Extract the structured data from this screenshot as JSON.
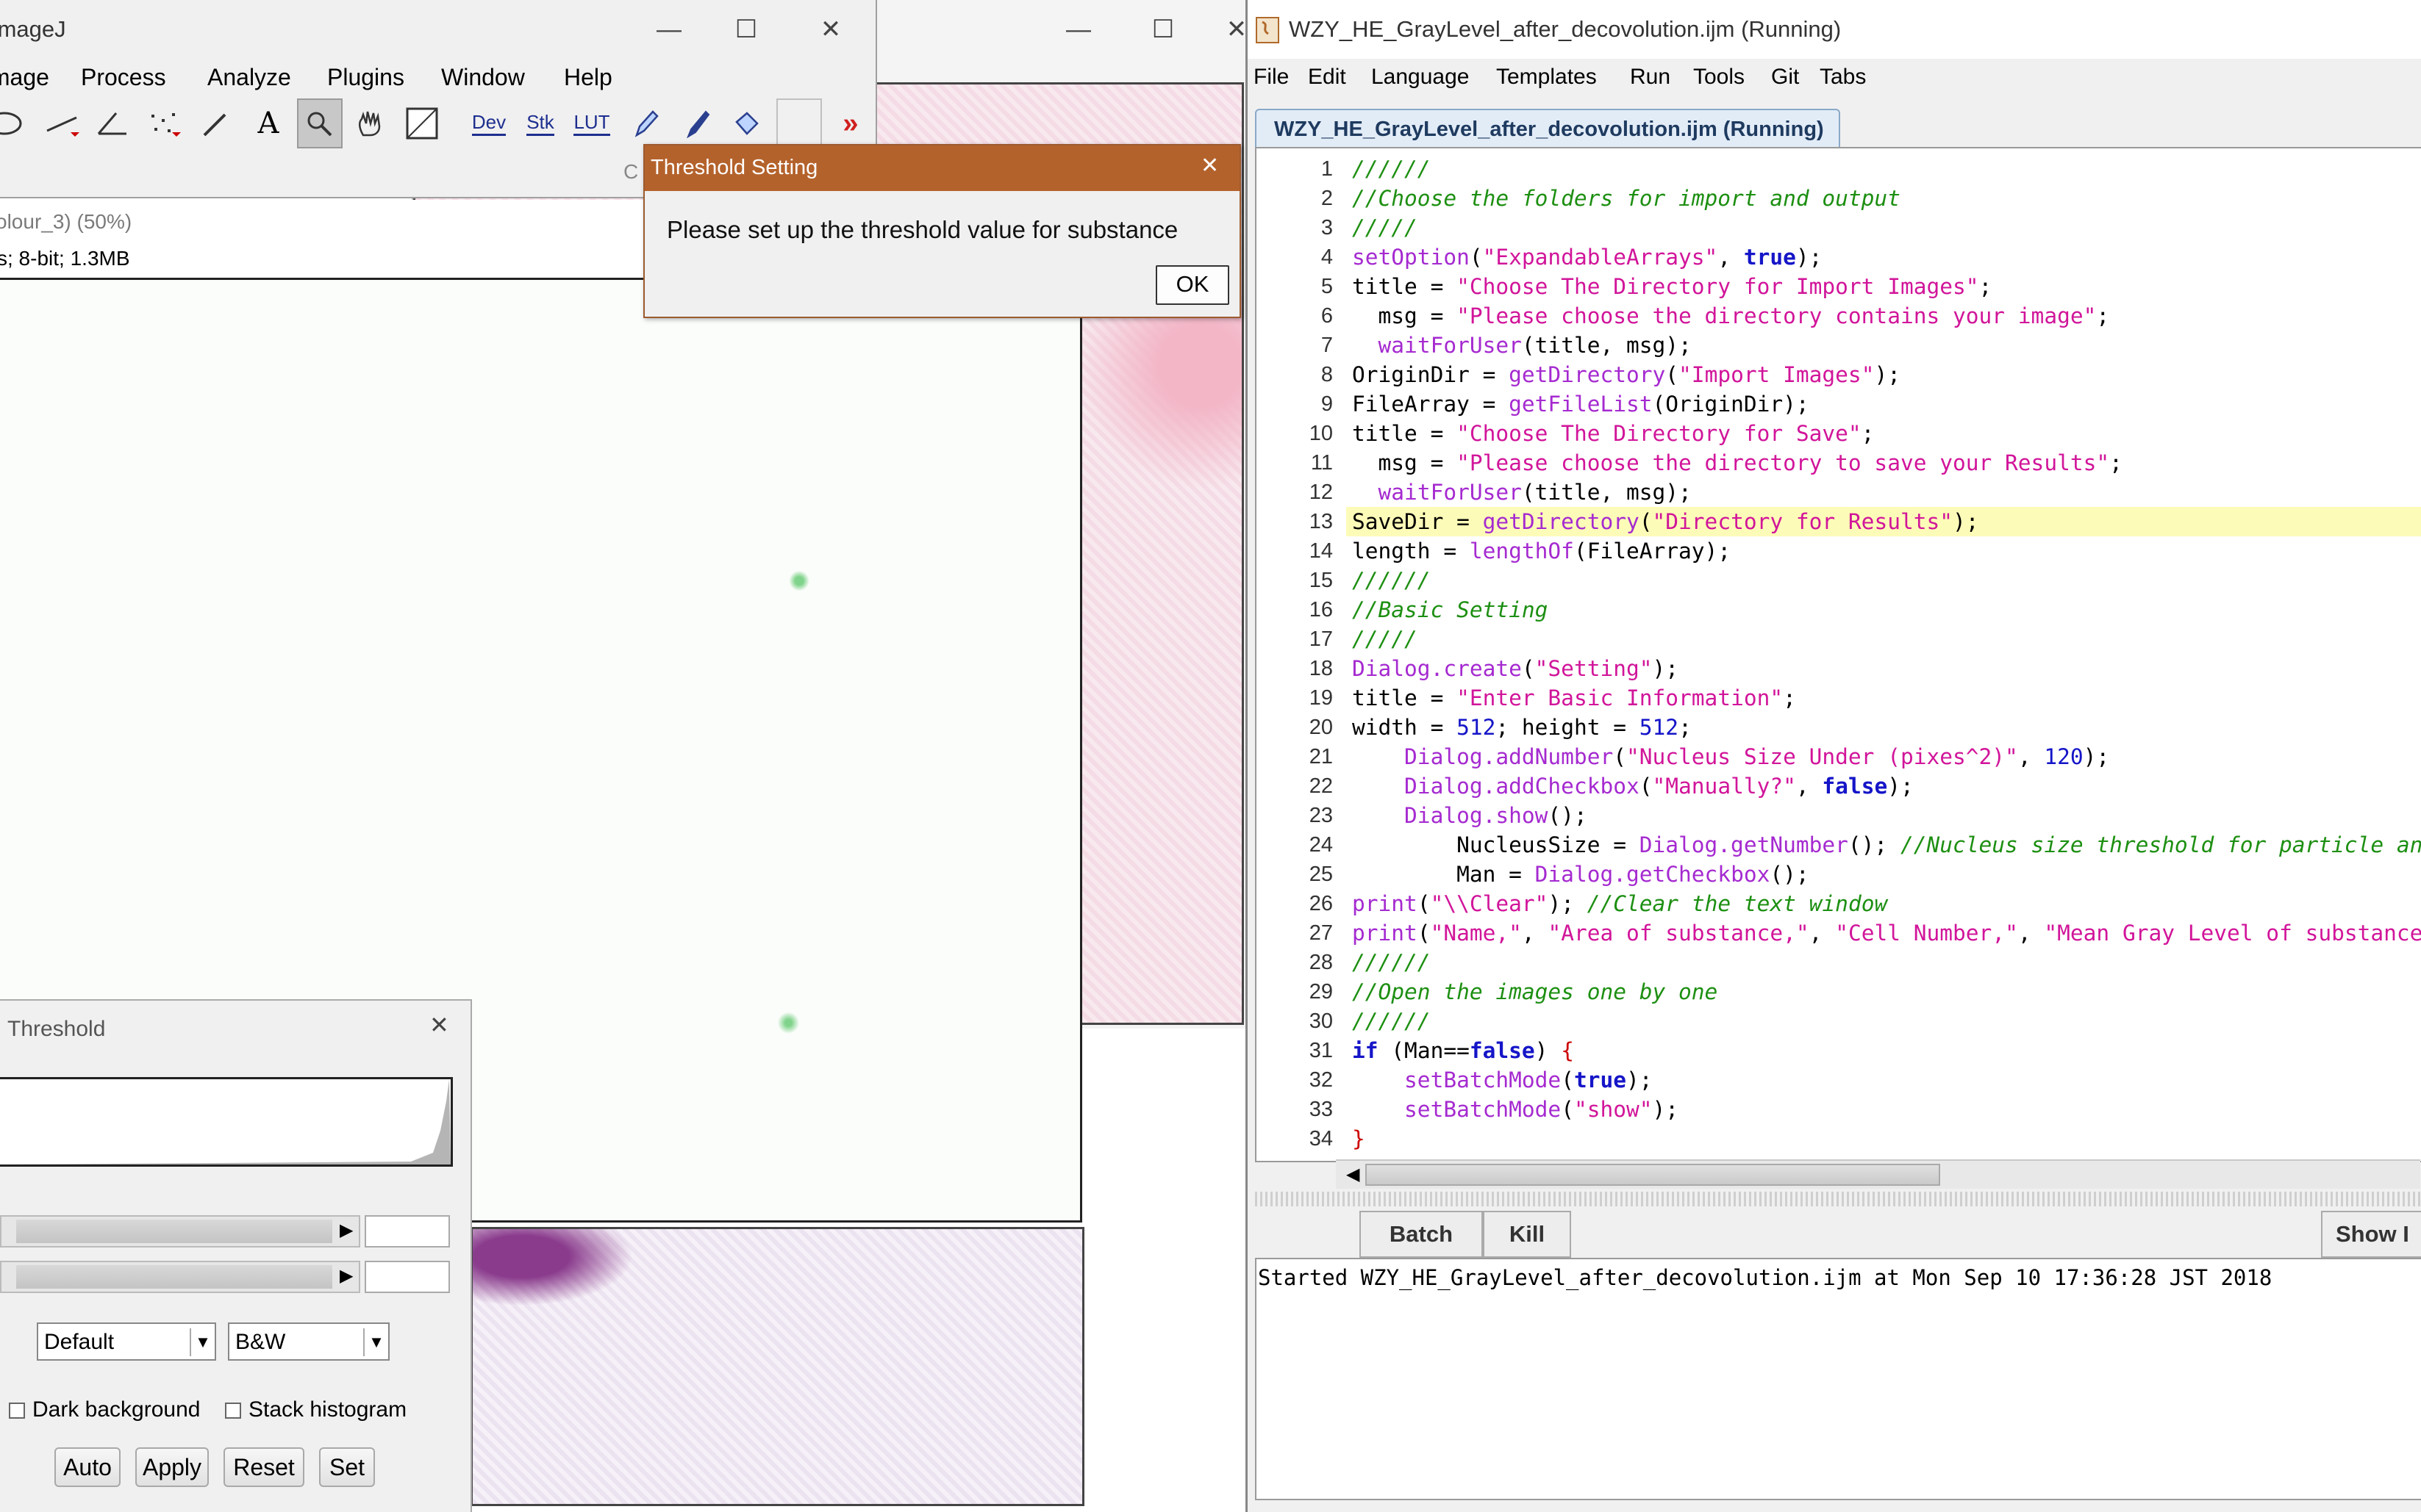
{
  "imagej": {
    "title": "ImageJ",
    "menus": [
      "Image",
      "Process",
      "Analyze",
      "Plugins",
      "Window",
      "Help"
    ],
    "tools": [
      {
        "icon": "freehand-selection-icon",
        "label": ""
      },
      {
        "icon": "straight-line-icon",
        "label": ""
      },
      {
        "icon": "angle-tool-icon",
        "label": ""
      },
      {
        "icon": "multi-point-icon",
        "label": ""
      },
      {
        "icon": "wand-tool-icon",
        "label": ""
      },
      {
        "icon": "text-tool-icon",
        "label": "A"
      },
      {
        "icon": "magnifier-icon",
        "label": ""
      },
      {
        "icon": "hand-tool-icon",
        "label": ""
      },
      {
        "icon": "color-picker-icon",
        "label": ""
      },
      {
        "icon": "dev-menu-icon",
        "label": "Dev"
      },
      {
        "icon": "stacks-menu-icon",
        "label": "Stk"
      },
      {
        "icon": "lut-menu-icon",
        "label": "LUT"
      },
      {
        "icon": "pencil-icon",
        "label": ""
      },
      {
        "icon": "brush-icon",
        "label": ""
      },
      {
        "icon": "flood-fill-icon",
        "label": ""
      },
      {
        "icon": "blank-tool-icon",
        "label": ""
      },
      {
        "icon": "more-tools-icon",
        "label": "»"
      }
    ],
    "status_fragment": "C"
  },
  "image_window": {
    "title": "olour_3) (50%)",
    "info": "s; 8-bit; 1.3MB"
  },
  "threshold_setting_dialog": {
    "title": "Threshold Setting",
    "message": "Please set up the threshold value for substance",
    "ok_label": "OK"
  },
  "threshold_panel": {
    "title": "Threshold",
    "method": "Default",
    "mode": "B&W",
    "dark_background_label": "Dark background",
    "stack_histogram_label": "Stack histogram",
    "dark_background_checked": false,
    "stack_histogram_checked": false,
    "buttons": [
      "Auto",
      "Apply",
      "Reset",
      "Set"
    ]
  },
  "editor": {
    "title": "WZY_HE_GrayLevel_after_decovolution.ijm (Running)",
    "tab_label": "WZY_HE_GrayLevel_after_decovolution.ijm (Running)",
    "menus": [
      "File",
      "Edit",
      "Language",
      "Templates",
      "Run",
      "Tools",
      "Git",
      "Tabs"
    ],
    "highlighted_line": 13,
    "line_numbers": [
      "1",
      "2",
      "3",
      "4",
      "5",
      "6",
      "7",
      "8",
      "9",
      "10",
      "11",
      "12",
      "13",
      "14",
      "15",
      "16",
      "17",
      "18",
      "19",
      "20",
      "21",
      "22",
      "23",
      "24",
      "25",
      "26",
      "27",
      "28",
      "29",
      "30",
      "31",
      "32",
      "33",
      "34"
    ],
    "code_lines": [
      "//////",
      "//Choose the folders for import and output",
      "/////",
      "setOption(\"ExpandableArrays\", true);",
      "title = \"Choose The Directory for Import Images\";",
      "  msg = \"Please choose the directory contains your image\";",
      "  waitForUser(title, msg);",
      "OriginDir = getDirectory(\"Import Images\");",
      "FileArray = getFileList(OriginDir);",
      "title = \"Choose The Directory for Save\";",
      "  msg = \"Please choose the directory to save your Results\";",
      "  waitForUser(title, msg);",
      "SaveDir = getDirectory(\"Directory for Results\");",
      "length = lengthOf(FileArray);",
      "//////",
      "//Basic Setting",
      "/////",
      "Dialog.create(\"Setting\");",
      "title = \"Enter Basic Information\";",
      "width = 512; height = 512;",
      "    Dialog.addNumber(\"Nucleus Size Under (pixes^2)\", 120);",
      "    Dialog.addCheckbox(\"Manually?\", false);",
      "    Dialog.show();",
      "        NucleusSize = Dialog.getNumber(); //Nucleus size threshold for particle analy",
      "        Man = Dialog.getCheckbox();",
      "print(\"\\\\Clear\"); //Clear the text window",
      "print(\"Name,\", \"Area of substance,\", \"Cell Number,\", \"Mean Gray Level of substance,\",",
      "//////",
      "//Open the images one by one",
      "//////",
      "if (Man==false) {",
      "    setBatchMode(true);",
      "    setBatchMode(\"show\");",
      "}"
    ],
    "buttons": [
      "Batch",
      "Kill"
    ],
    "show_button_label": "Show I",
    "console_text": "Started WZY_HE_GrayLevel_after_decovolution.ijm at Mon Sep 10 17:36:28 JST 2018"
  },
  "colors": {
    "dialog_title_bar": "#b4622c",
    "highlight_line": "#fdfbb8",
    "keyword": "#1515c8",
    "function": "#a52ad0",
    "string": "#d1159a",
    "comment": "#1d8f12"
  }
}
